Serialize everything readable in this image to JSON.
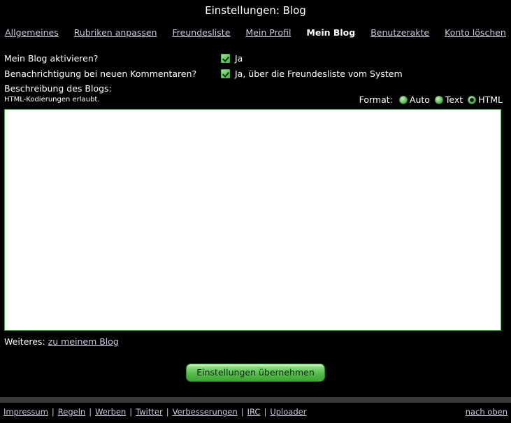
{
  "header": {
    "title": "Einstellungen: Blog"
  },
  "nav": {
    "items": [
      {
        "label": "Allgemeines",
        "active": false
      },
      {
        "label": "Rubriken anpassen",
        "active": false
      },
      {
        "label": "Freundesliste",
        "active": false
      },
      {
        "label": "Mein Profil",
        "active": false
      },
      {
        "label": "Mein Blog",
        "active": true
      },
      {
        "label": "Benutzerakte",
        "active": false
      },
      {
        "label": "Konto löschen",
        "active": false
      }
    ]
  },
  "form": {
    "rows": [
      {
        "label": "Mein Blog aktivieren?",
        "checkbox_label": "Ja",
        "checked": true
      },
      {
        "label": "Benachrichtigung bei neuen Kommentaren?",
        "checkbox_label": "Ja, über die Freundesliste vom System",
        "checked": true
      }
    ],
    "description": {
      "title": "Beschreibung des Blogs:",
      "subtitle": "HTML-Kodierungen erlaubt.",
      "textarea_value": "",
      "textarea_placeholder": ""
    },
    "format": {
      "label": "Format:",
      "options": [
        {
          "label": "Auto",
          "selected": false
        },
        {
          "label": "Text",
          "selected": false
        },
        {
          "label": "HTML",
          "selected": true
        }
      ]
    },
    "weiteres": {
      "label": "Weiteres:",
      "link_label": "zu meinem Blog"
    },
    "submit_label": "Einstellungen übernehmen"
  },
  "footer": {
    "links": [
      "Impressum",
      "Regeln",
      "Werben",
      "Twitter",
      "Verbesserungen",
      "IRC",
      "Uploader"
    ],
    "separator": "|",
    "top_link": "nach oben"
  },
  "colors": {
    "background": "#000000",
    "accent_green": "#4eaa4b",
    "link": "#c8c8dc",
    "text": "#ffffff",
    "divider": "#3a3a3a"
  }
}
